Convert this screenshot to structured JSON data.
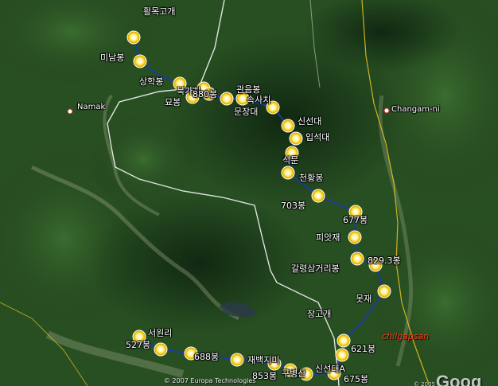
{
  "peaks": [
    {
      "name": "활목고개"
    },
    {
      "name": "미남봉"
    },
    {
      "name": "상학봉"
    },
    {
      "name": "북가치"
    },
    {
      "name": "묘봉"
    },
    {
      "name": "880봉"
    },
    {
      "name": "관음봉"
    },
    {
      "name": "속사치"
    },
    {
      "name": "문장대"
    },
    {
      "name": "신선대"
    },
    {
      "name": "입석대"
    },
    {
      "name": "석문"
    },
    {
      "name": "천황봉"
    },
    {
      "name": "703봉"
    },
    {
      "name": "677봉"
    },
    {
      "name": "피앗재"
    },
    {
      "name": "829.3봉"
    },
    {
      "name": "갈령삼거리봉"
    },
    {
      "name": "못재"
    },
    {
      "name": "장고개"
    },
    {
      "name": "621봉"
    },
    {
      "name": "신선대A"
    },
    {
      "name": "675봉"
    },
    {
      "name": "서원리"
    },
    {
      "name": "527봉"
    },
    {
      "name": "688봉"
    },
    {
      "name": "재백지미"
    },
    {
      "name": "853봉"
    },
    {
      "name": "구병산"
    }
  ],
  "towns": [
    {
      "name": "Namak"
    },
    {
      "name": "Changam-ni"
    }
  ],
  "region_label": "chilgapsan",
  "attribution": "© 2007 Europa Technologies",
  "year_mark": "© 2005",
  "logo": "Goog",
  "colors": {
    "forest": "#2d5a27",
    "route": "#1b3aa8",
    "roads": "#ffffff",
    "boundary": "#e0c020",
    "accent_label": "#ff3a1a",
    "marker_ring": "#f5c400"
  }
}
